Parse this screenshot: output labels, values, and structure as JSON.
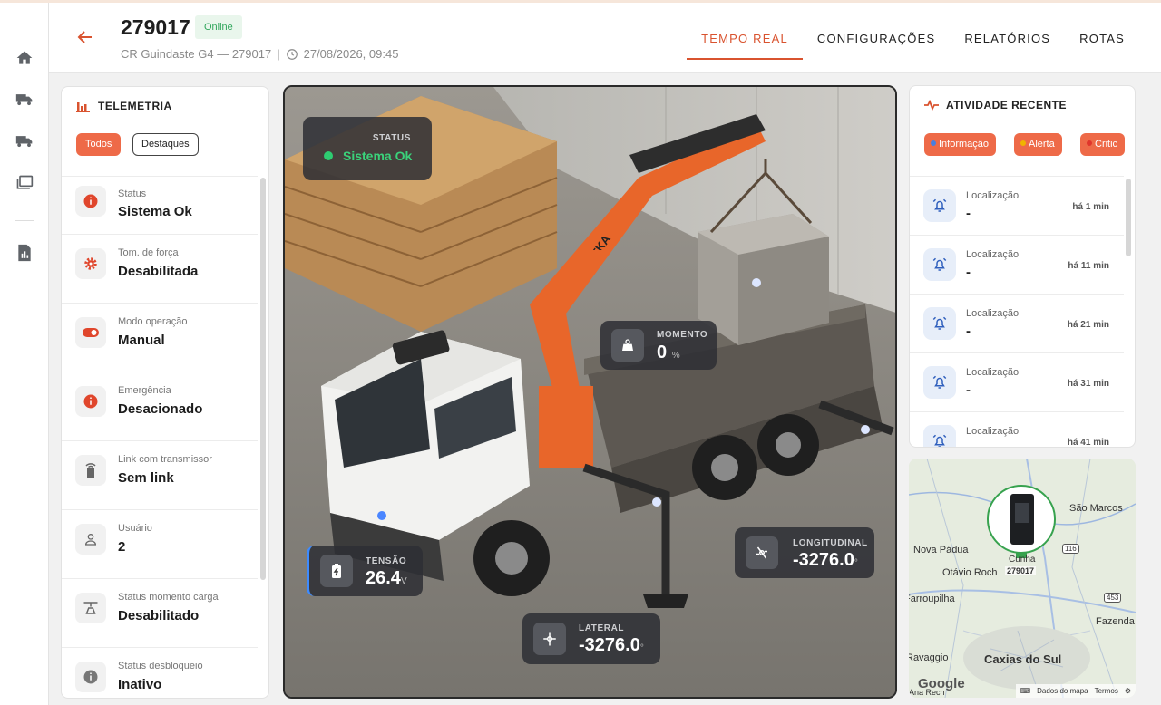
{
  "header": {
    "vehicle_id": "279017",
    "status_badge": "Online",
    "subtitle": "CR Guindaste G4 — 279017",
    "separator": "|",
    "datetime": "27/08/2026, 09:45",
    "tabs": [
      {
        "label": "TEMPO REAL",
        "active": true
      },
      {
        "label": "CONFIGURAÇÕES",
        "active": false
      },
      {
        "label": "RELATÓRIOS",
        "active": false
      },
      {
        "label": "ROTAS",
        "active": false
      }
    ]
  },
  "nav_icons": [
    "home-icon",
    "truck-icon",
    "truck-icon",
    "folders-icon",
    "report-icon"
  ],
  "telemetry": {
    "title": "TELEMETRIA",
    "filters": [
      "Todos",
      "Destaques"
    ],
    "items": [
      {
        "label": "Status",
        "value": "Sistema Ok",
        "icon": "info-icon"
      },
      {
        "label": "Tom. de força",
        "value": "Desabilitada",
        "icon": "gear-icon"
      },
      {
        "label": "Modo operação",
        "value": "Manual",
        "icon": "toggle-icon"
      },
      {
        "label": "Emergência",
        "value": "Desacionado",
        "icon": "info-icon"
      },
      {
        "label": "Link com transmissor",
        "value": "Sem link",
        "icon": "remote-icon"
      },
      {
        "label": "Usuário",
        "value": "2",
        "icon": "user-icon"
      },
      {
        "label": "Status momento carga",
        "value": "Desabilitado",
        "icon": "crane-load-icon"
      },
      {
        "label": "Status desbloqueio",
        "value": "Inativo",
        "icon": "info-icon"
      }
    ]
  },
  "scene": {
    "crane_label": "TKA",
    "status": {
      "label": "STATUS",
      "value": "Sistema Ok"
    },
    "momento": {
      "label": "MOMENTO",
      "value": "0",
      "unit": "%"
    },
    "tensao": {
      "label": "TENSÃO",
      "value": "26.4",
      "unit": "V"
    },
    "longitudinal": {
      "label": "LONGITUDINAL",
      "value": "-3276.0",
      "unit": "°"
    },
    "lateral": {
      "label": "LATERAL",
      "value": "-3276.0",
      "unit": "°"
    }
  },
  "activity": {
    "title": "ATIVIDADE RECENTE",
    "filters": [
      {
        "label": "Informação",
        "dot": "#4a7ee0"
      },
      {
        "label": "Alerta",
        "dot": "#f0b400"
      },
      {
        "label": "Critic",
        "dot": "#e0362c"
      }
    ],
    "items": [
      {
        "label": "Localização",
        "value": "-",
        "time": "há 1 min"
      },
      {
        "label": "Localização",
        "value": "-",
        "time": "há 11 min"
      },
      {
        "label": "Localização",
        "value": "-",
        "time": "há 21 min"
      },
      {
        "label": "Localização",
        "value": "-",
        "time": "há 31 min"
      },
      {
        "label": "Localização",
        "value": "-",
        "time": "há 41 min"
      }
    ]
  },
  "map": {
    "places": [
      "São Marcos",
      "Nova Pádua",
      "Otávio Roch",
      "Farroupilha",
      "Fazenda",
      "Caxias do Sul",
      "Ravaggio",
      "Ana Rech"
    ],
    "marker_label": "Cunha",
    "marker_id": "279017",
    "highways": [
      "116",
      "453"
    ],
    "logo": "Google",
    "attribution": "Dados do mapa",
    "terms": "Termos"
  },
  "colors": {
    "accent": "#d9532f",
    "chip": "#ee6a48",
    "online": "#2ea55a",
    "status_ok": "#2ecc71"
  }
}
